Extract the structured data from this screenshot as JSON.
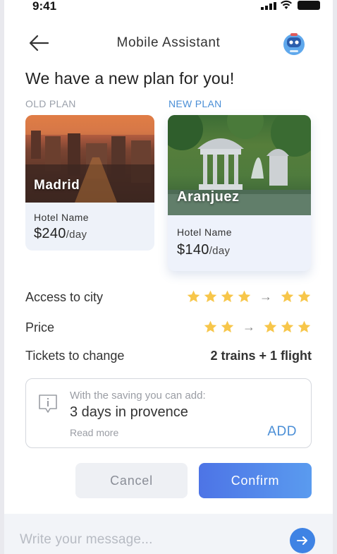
{
  "status": {
    "time": "9:41"
  },
  "header": {
    "title": "Mobile Assistant",
    "back_icon": "arrow-left-icon",
    "avatar_icon": "robot-icon"
  },
  "headline": "We have a new plan for you!",
  "plans": {
    "old": {
      "label": "OLD PLAN",
      "city": "Madrid",
      "hotel": "Hotel Name",
      "price": "$240",
      "unit": "/day"
    },
    "new": {
      "label": "NEW PLAN",
      "city": "Aranjuez",
      "hotel": "Hotel Name",
      "price": "$140",
      "unit": "/day"
    }
  },
  "comparison": [
    {
      "label": "Access to city",
      "from_stars": 4,
      "to_stars": 2
    },
    {
      "label": "Price",
      "from_stars": 2,
      "to_stars": 3
    },
    {
      "label": "Tickets to change",
      "value": "2 trains + 1 flight"
    }
  ],
  "arrow_glyph": "→",
  "info": {
    "subtitle": "With the saving you can add:",
    "main": "3 days in provence",
    "read_more": "Read more",
    "add": "ADD"
  },
  "buttons": {
    "cancel": "Cancel",
    "confirm": "Confirm"
  },
  "message": {
    "placeholder": "Write your message..."
  },
  "colors": {
    "accent": "#4a8ed6",
    "star": "#f7c64a",
    "confirm_start": "#4d74e6",
    "confirm_end": "#5a9bef"
  }
}
